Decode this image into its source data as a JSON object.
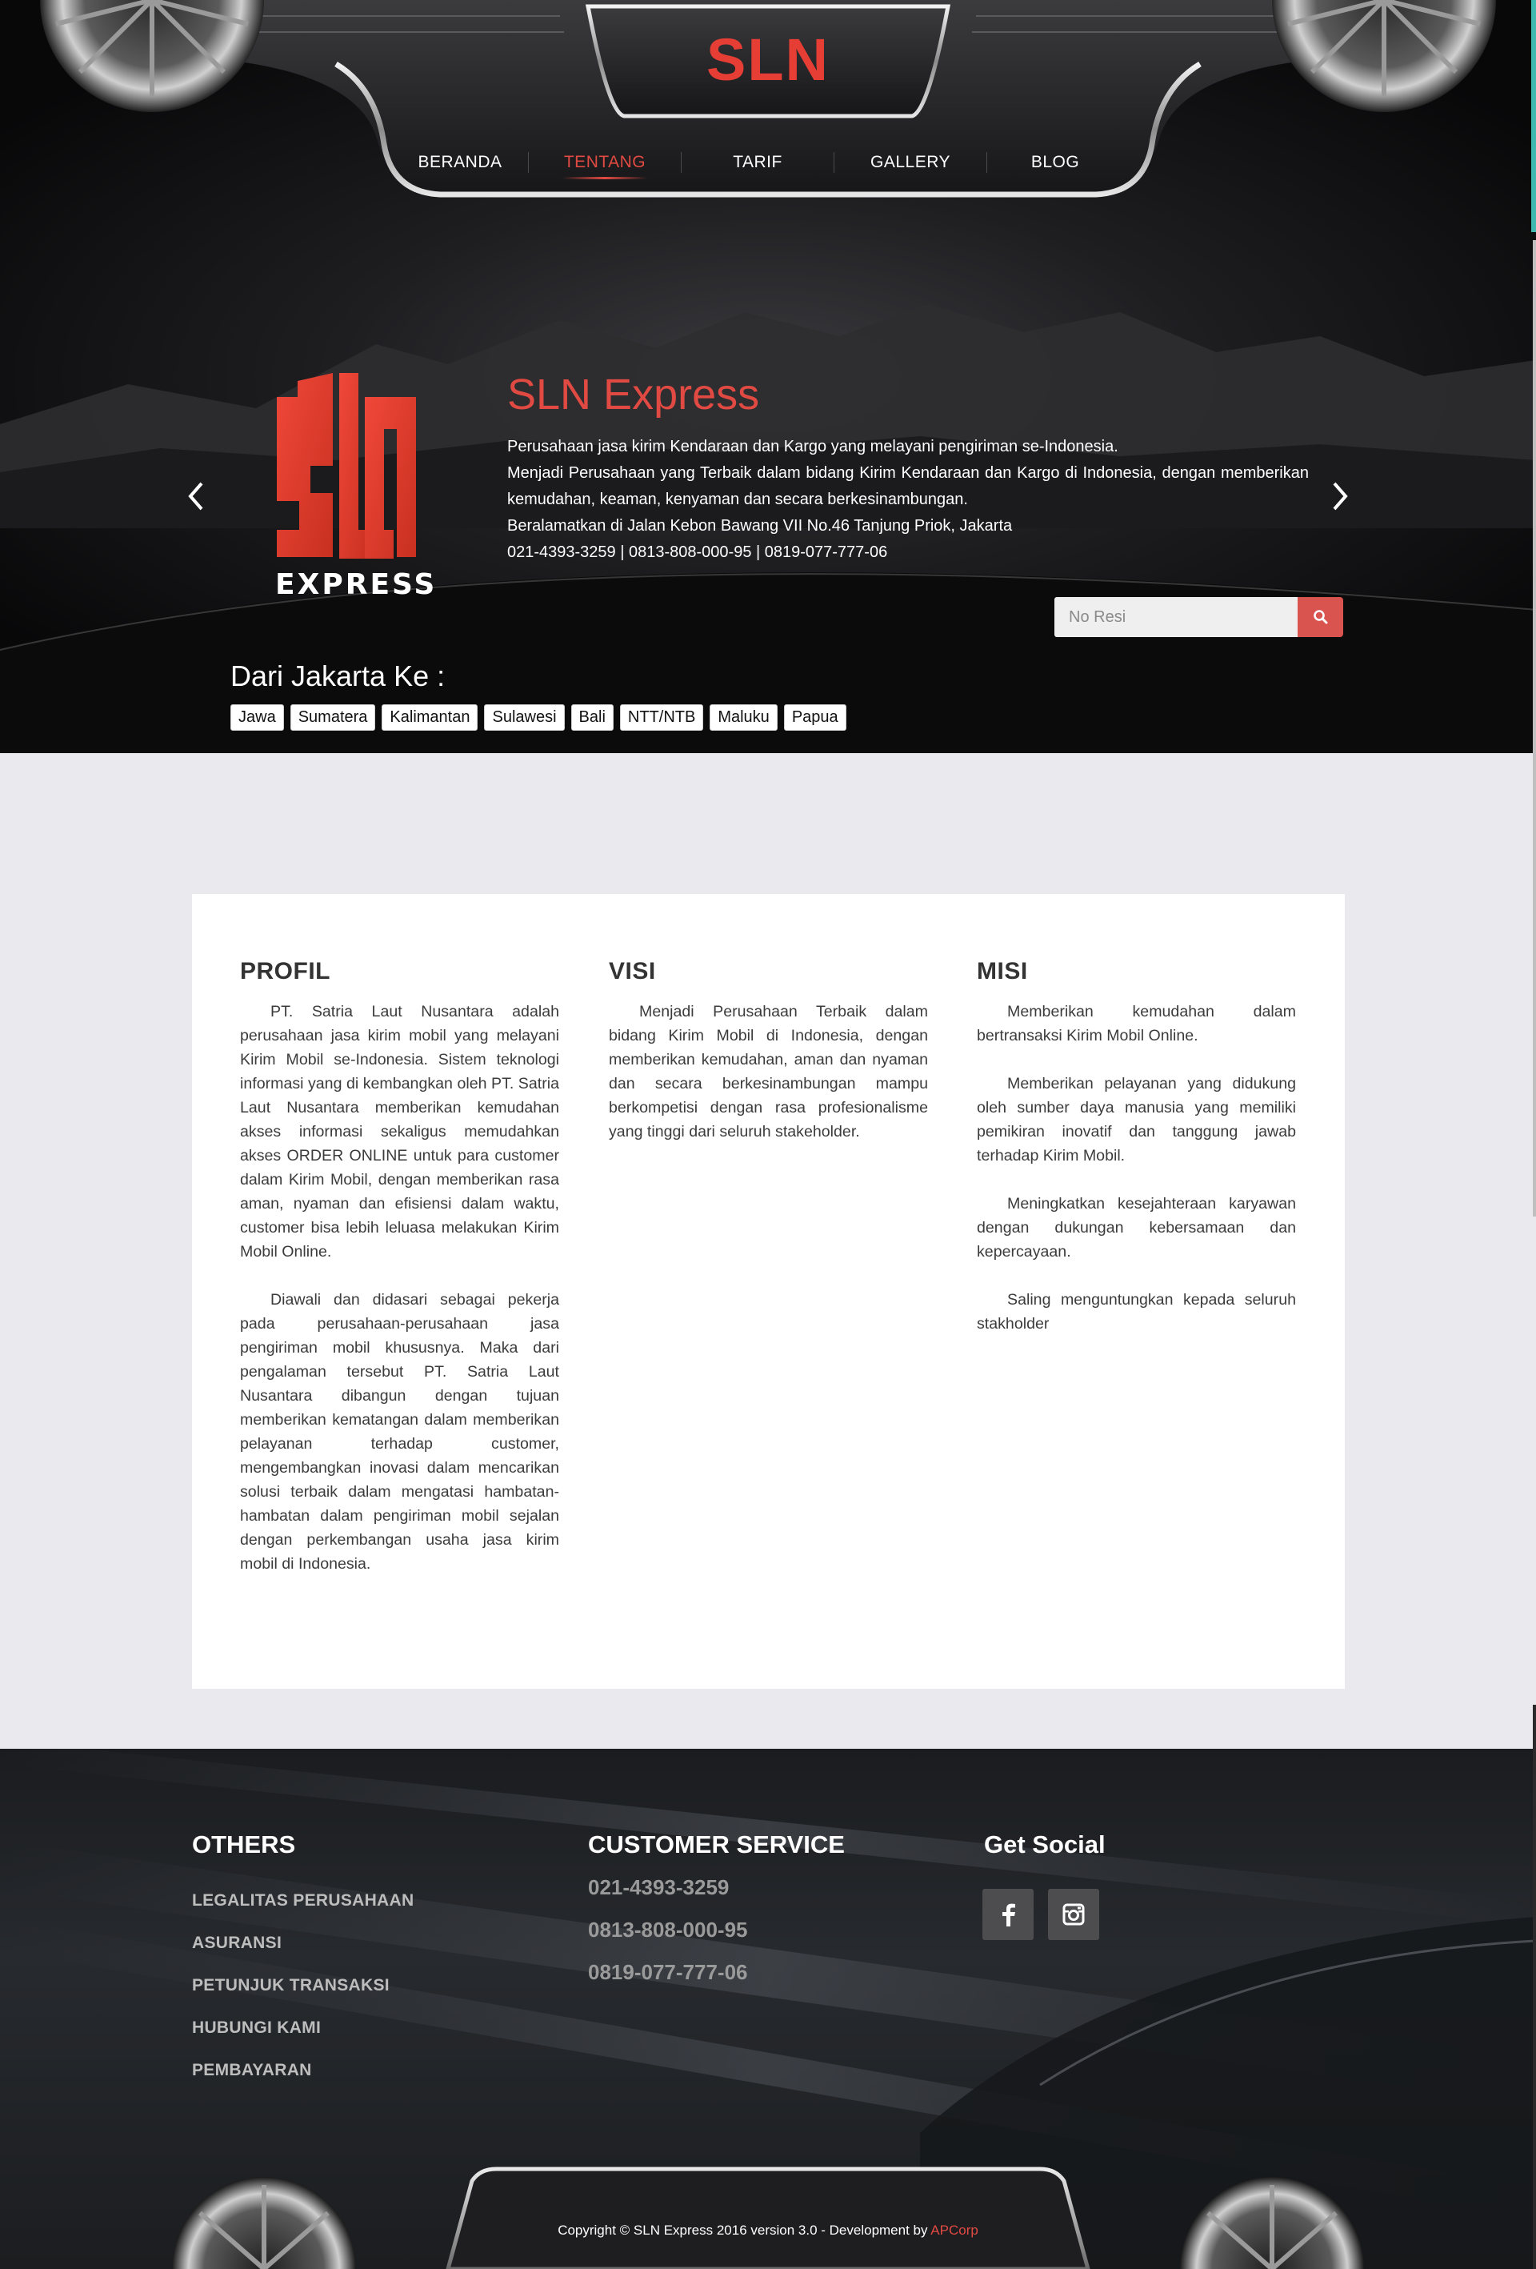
{
  "header": {
    "logo": "SLN",
    "nav": [
      {
        "label": "BERANDA",
        "active": false
      },
      {
        "label": "TENTANG",
        "active": true
      },
      {
        "label": "TARIF",
        "active": false
      },
      {
        "label": "GALLERY",
        "active": false
      },
      {
        "label": "BLOG",
        "active": false
      }
    ]
  },
  "hero": {
    "brand_logo_text": "EXPRESS",
    "title": "SLN Express",
    "lines": [
      "Perusahaan jasa kirim Kendaraan dan Kargo yang melayani pengiriman se-Indonesia.",
      "Menjadi Perusahaan yang Terbaik dalam bidang Kirim Kendaraan dan Kargo di Indonesia, dengan memberikan kemudahan, keaman, kenyaman dan secara berkesinambungan.",
      "Beralamatkan di Jalan Kebon Bawang VII No.46 Tanjung Priok, Jakarta",
      "021-4393-3259 | 0813-808-000-95 | 0819-077-777-06"
    ],
    "resi_placeholder": "No Resi",
    "dest_title": "Dari Jakarta Ke :",
    "destinations": [
      "Jawa",
      "Sumatera",
      "Kalimantan",
      "Sulawesi",
      "Bali",
      "NTT/NTB",
      "Maluku",
      "Papua"
    ]
  },
  "content": {
    "profil": {
      "title": "PROFIL",
      "paragraphs": [
        "PT. Satria Laut Nusantara adalah perusahaan jasa kirim mobil yang melayani Kirim Mobil se-Indonesia. Sistem teknologi informasi yang di kembangkan oleh PT. Satria Laut Nusantara memberikan kemudahan akses informasi sekaligus memudahkan akses ORDER ONLINE untuk para customer dalam Kirim Mobil, dengan memberikan rasa aman, nyaman dan efisiensi dalam waktu, customer bisa lebih leluasa melakukan Kirim Mobil Online.",
        "Diawali dan didasari sebagai pekerja pada perusahaan-perusahaan jasa pengiriman mobil khususnya. Maka dari pengalaman tersebut PT. Satria Laut Nusantara dibangun dengan tujuan memberikan kematangan dalam memberikan pelayanan terhadap customer, mengembangkan inovasi dalam mencarikan solusi terbaik dalam mengatasi hambatan-hambatan dalam pengiriman mobil sejalan dengan perkembangan usaha jasa kirim mobil di Indonesia."
      ]
    },
    "visi": {
      "title": "VISI",
      "paragraphs": [
        "Menjadi Perusahaan Terbaik dalam bidang Kirim Mobil di Indonesia, dengan memberikan kemudahan, aman dan nyaman dan secara berkesinambungan mampu berkompetisi dengan rasa profesionalisme yang tinggi dari seluruh stakeholder."
      ]
    },
    "misi": {
      "title": "MISI",
      "paragraphs": [
        "Memberikan kemudahan dalam bertransaksi Kirim Mobil Online.",
        "Memberikan pelayanan yang didukung oleh sumber daya manusia yang memiliki pemikiran inovatif dan tanggung jawab terhadap Kirim Mobil.",
        "Meningkatkan kesejahteraan karyawan dengan dukungan kebersamaan dan kepercayaan.",
        "Saling menguntungkan kepada seluruh stakholder"
      ]
    }
  },
  "footer": {
    "others_title": "OTHERS",
    "others_links": [
      "LEGALITAS PERUSAHAAN",
      "ASURANSI",
      "PETUNJUK TRANSAKSI",
      "HUBUNGI KAMI",
      "PEMBAYARAN"
    ],
    "cs_title": "CUSTOMER SERVICE",
    "cs_numbers": [
      "021-4393-3259",
      "0813-808-000-95",
      "0819-077-777-06"
    ],
    "social_title": "Get Social",
    "social_icons": [
      "facebook-icon",
      "instagram-icon"
    ],
    "copyright": "Copyright © SLN Express 2016 version 3.0 - Development by ",
    "developer": "APCorp"
  },
  "colors": {
    "accent": "#e14a42",
    "background": "#e9e9ee",
    "button": "#d9534f"
  }
}
